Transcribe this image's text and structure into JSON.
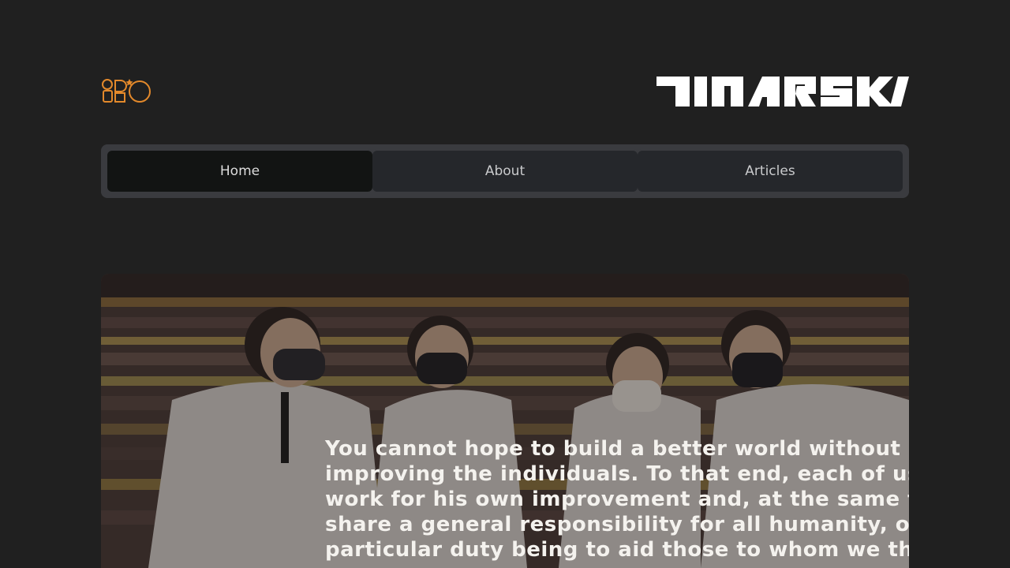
{
  "header": {
    "logo_icon": "shapes-logo-icon",
    "brand_icon": "dinarski-wordmark-logo",
    "accent_color": "#e3892b"
  },
  "nav": {
    "tabs": [
      {
        "label": "Home",
        "active": true
      },
      {
        "label": "About",
        "active": false
      },
      {
        "label": "Articles",
        "active": false
      }
    ]
  },
  "hero": {
    "image_icon": "students-photo",
    "quote": "You cannot hope to build a better world without\nimproving the individuals. To that end, each of us\nwork for his own improvement and, at the same t\nshare a general responsibility for all humanity, o\nparticular duty being to aid those to whom we thi"
  }
}
